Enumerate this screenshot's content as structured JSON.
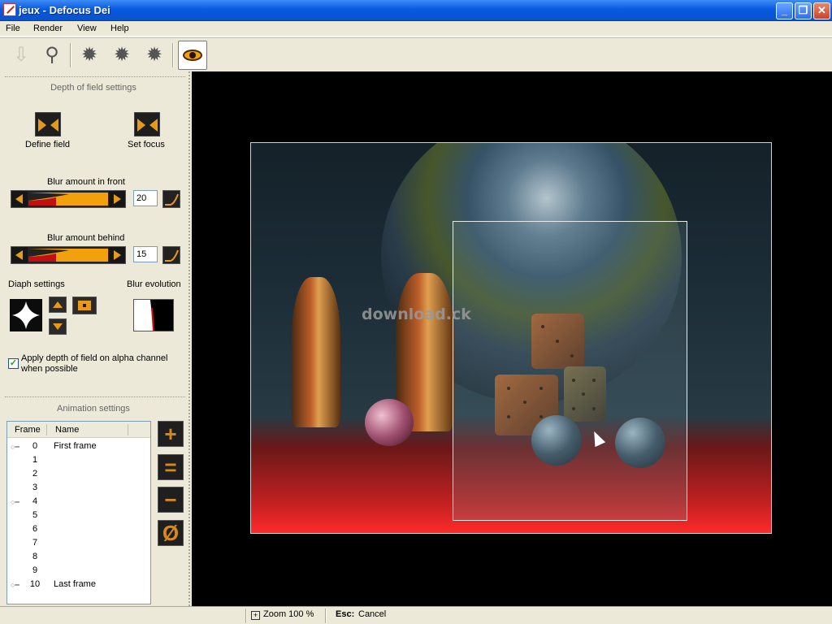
{
  "window": {
    "title": "jeux - Defocus Dei"
  },
  "menu": {
    "items": [
      "File",
      "Render",
      "View",
      "Help"
    ]
  },
  "dof": {
    "section_title": "Depth of field settings",
    "define_field_label": "Define field",
    "set_focus_label": "Set focus",
    "blur_front_label": "Blur amount in front",
    "blur_front_value": "20",
    "blur_behind_label": "Blur amount behind",
    "blur_behind_value": "15",
    "diaph_label": "Diaph settings",
    "blur_evolution_label": "Blur evolution",
    "alpha_checkbox_label": "Apply depth of field on alpha channel when possible",
    "alpha_checked": true
  },
  "animation": {
    "section_title": "Animation settings",
    "columns": [
      "Frame",
      "Name"
    ],
    "frames": [
      {
        "frame": "0",
        "name": "First frame",
        "key": true
      },
      {
        "frame": "1",
        "name": "",
        "key": false
      },
      {
        "frame": "2",
        "name": "",
        "key": false
      },
      {
        "frame": "3",
        "name": "",
        "key": false
      },
      {
        "frame": "4",
        "name": "",
        "key": true
      },
      {
        "frame": "5",
        "name": "",
        "key": false
      },
      {
        "frame": "6",
        "name": "",
        "key": false
      },
      {
        "frame": "7",
        "name": "",
        "key": false
      },
      {
        "frame": "8",
        "name": "",
        "key": false
      },
      {
        "frame": "9",
        "name": "",
        "key": false
      },
      {
        "frame": "10",
        "name": "Last frame",
        "key": true
      }
    ],
    "buttons": [
      "+",
      "=",
      "−",
      "Ø"
    ]
  },
  "canvas": {
    "watermark": "download.ck"
  },
  "status": {
    "zoom": "Zoom 100 %",
    "esc_key": "Esc:",
    "esc_action": "Cancel"
  },
  "colors": {
    "accent_orange": "#f2a10c",
    "titlebar_blue": "#0a5ae0",
    "panel_bg": "#ece9d8"
  }
}
